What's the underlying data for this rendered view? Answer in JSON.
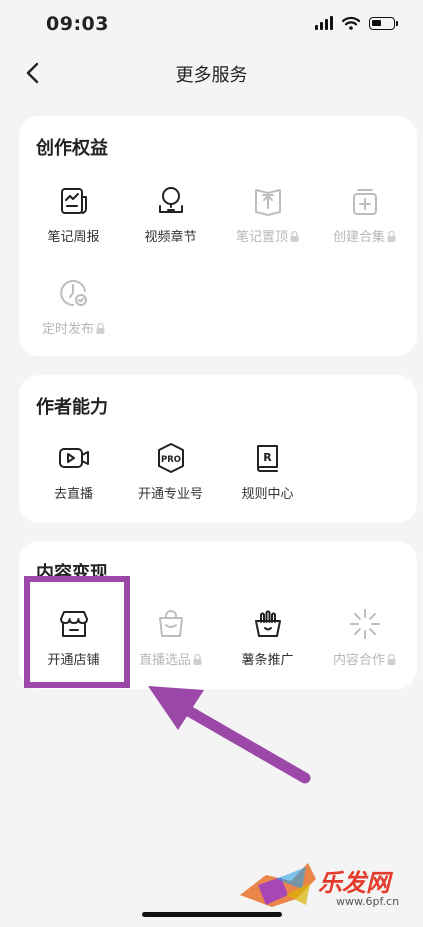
{
  "status_bar": {
    "time": "09:03"
  },
  "nav": {
    "title": "更多服务"
  },
  "sections": [
    {
      "title": "创作权益",
      "items": [
        {
          "label": "笔记周报",
          "icon": "report-chart-icon",
          "locked": false
        },
        {
          "label": "视频章节",
          "icon": "video-chapter-icon",
          "locked": false
        },
        {
          "label": "笔记置顶",
          "icon": "pin-top-icon",
          "locked": true
        },
        {
          "label": "创建合集",
          "icon": "collection-add-icon",
          "locked": true
        },
        {
          "label": "定时发布",
          "icon": "scheduled-publish-icon",
          "locked": true
        }
      ]
    },
    {
      "title": "作者能力",
      "items": [
        {
          "label": "去直播",
          "icon": "live-camera-icon",
          "locked": false
        },
        {
          "label": "开通专业号",
          "icon": "pro-badge-icon",
          "locked": false
        },
        {
          "label": "规则中心",
          "icon": "rules-book-icon",
          "locked": false
        }
      ]
    },
    {
      "title": "内容变现",
      "items": [
        {
          "label": "开通店铺",
          "icon": "shop-icon",
          "locked": false
        },
        {
          "label": "直播选品",
          "icon": "shopping-bag-icon",
          "locked": true
        },
        {
          "label": "薯条推广",
          "icon": "fries-icon",
          "locked": false
        },
        {
          "label": "内容合作",
          "icon": "sparkle-collab-icon",
          "locked": true
        }
      ]
    }
  ],
  "annotation": {
    "color": "#9b48a8"
  },
  "watermark": {
    "text": "乐发网",
    "url": "www.6pf.cn"
  }
}
